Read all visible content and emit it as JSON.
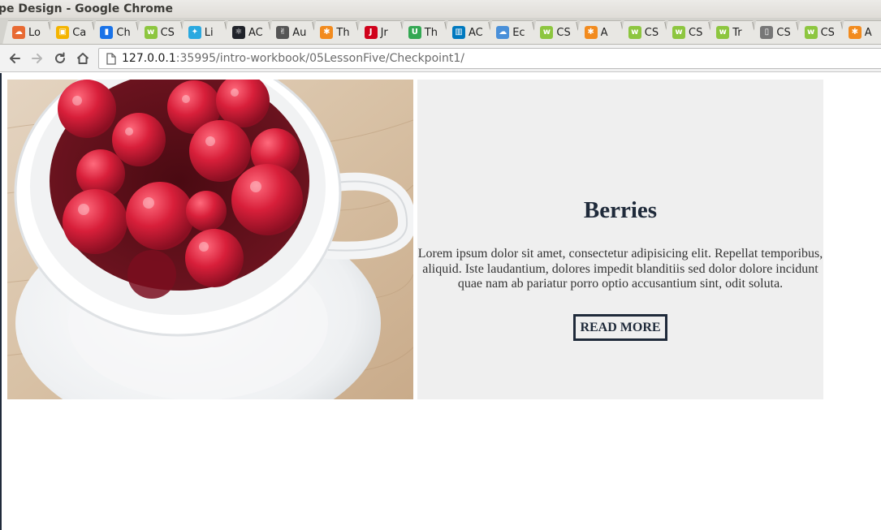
{
  "window": {
    "title": "pe Design - Google Chrome"
  },
  "tabs": [
    {
      "label": "Lo",
      "favicon": "cloud-icon",
      "favicon_color": "#e86a33"
    },
    {
      "label": "Ca",
      "favicon": "calendar-icon",
      "favicon_color": "#f4b400"
    },
    {
      "label": "Ch",
      "favicon": "bookmark-icon",
      "favicon_color": "#1a73e8"
    },
    {
      "label": "CS",
      "favicon": "w3-icon",
      "favicon_color": "#8dc63f"
    },
    {
      "label": "Li",
      "favicon": "network-icon",
      "favicon_color": "#2aa9e0"
    },
    {
      "label": "AC",
      "favicon": "react-icon",
      "favicon_color": "#20232a"
    },
    {
      "label": "Au",
      "favicon": "peace-hand-icon",
      "favicon_color": "#555555"
    },
    {
      "label": "Th",
      "favicon": "asterisk-icon",
      "favicon_color": "#f28b1e"
    },
    {
      "label": "Jr",
      "favicon": "jira-icon",
      "favicon_color": "#d0021b"
    },
    {
      "label": "Th",
      "favicon": "u-icon",
      "favicon_color": "#34a853"
    },
    {
      "label": "AC",
      "favicon": "trello-icon",
      "favicon_color": "#0079bf"
    },
    {
      "label": "Ec",
      "favicon": "cloud-outline-icon",
      "favicon_color": "#4a90d9"
    },
    {
      "label": "CS",
      "favicon": "w3-icon",
      "favicon_color": "#8dc63f"
    },
    {
      "label": "A",
      "favicon": "asterisk-icon",
      "favicon_color": "#f28b1e"
    },
    {
      "label": "CS",
      "favicon": "w3-icon",
      "favicon_color": "#8dc63f"
    },
    {
      "label": "CS",
      "favicon": "w3-icon",
      "favicon_color": "#8dc63f"
    },
    {
      "label": "Tr",
      "favicon": "w3-icon",
      "favicon_color": "#8dc63f"
    },
    {
      "label": "CS",
      "favicon": "page-icon",
      "favicon_color": "#777777"
    },
    {
      "label": "CS",
      "favicon": "w3-icon",
      "favicon_color": "#8dc63f"
    },
    {
      "label": "A",
      "favicon": "asterisk-icon",
      "favicon_color": "#f28b1e"
    }
  ],
  "toolbar": {
    "url_host": "127.0.0.1",
    "url_path": ":35995/intro-workbook/05LessonFive/Checkpoint1/"
  },
  "card": {
    "image_alt": "raspberries-in-white-cup",
    "title": "Berries",
    "text": "Lorem ipsum dolor sit amet, consectetur adipisicing elit. Repellat temporibus, aliquid. Iste laudantium, dolores impedit blanditiis sed dolor dolore incidunt quae nam ab pariatur porro optio accusantium sint, odit soluta.",
    "button_label": "READ MORE",
    "accent_color": "#1f2a3a",
    "panel_color": "#efefef"
  }
}
